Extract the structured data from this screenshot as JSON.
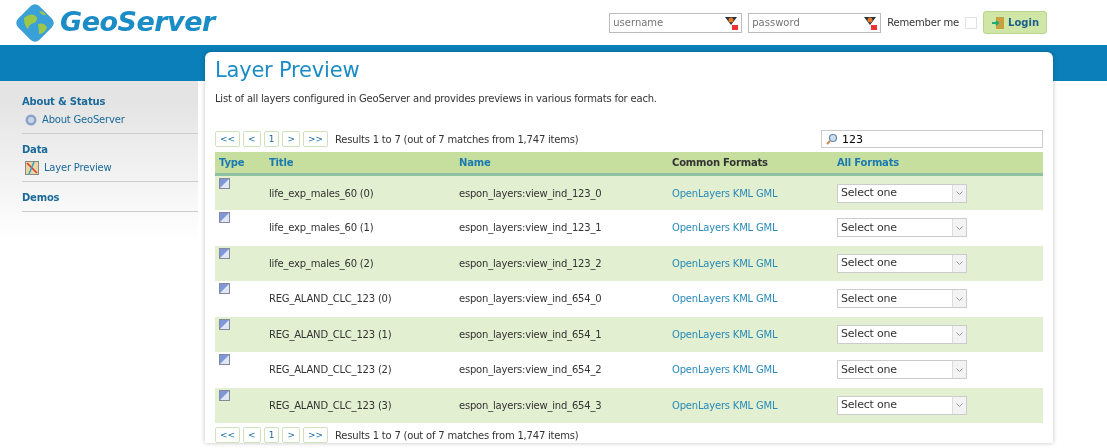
{
  "logo": {
    "text": "GeoServer"
  },
  "login": {
    "username_placeholder": "username",
    "password_placeholder": "password",
    "remember_label": "Remember me",
    "remember_checked": false,
    "button": "Login"
  },
  "sidebar": {
    "sections": [
      {
        "title": "About & Status",
        "items": [
          {
            "label": "About GeoServer"
          }
        ]
      },
      {
        "title": "Data",
        "items": [
          {
            "label": "Layer Preview"
          }
        ]
      },
      {
        "title": "Demos"
      }
    ]
  },
  "page": {
    "title": "Layer Preview",
    "description": "List of all layers configured in GeoServer and provides previews in various formats for each."
  },
  "pager_top": {
    "buttons": [
      "<<",
      "<",
      "1",
      ">",
      ">>"
    ],
    "summary": "Results 1 to 7 (out of 7 matches from 1,747 items)"
  },
  "search": {
    "value": "123"
  },
  "table": {
    "columns": [
      "Type",
      "Title",
      "Name",
      "Common Formats",
      "All Formats"
    ],
    "rows": [
      {
        "title": "life_exp_males_60 (0)",
        "name": "espon_layers:view_ind_123_0",
        "formats": [
          "OpenLayers",
          "KML",
          "GML"
        ],
        "select": "Select one"
      },
      {
        "title": "life_exp_males_60 (1)",
        "name": "espon_layers:view_ind_123_1",
        "formats": [
          "OpenLayers",
          "KML",
          "GML"
        ],
        "select": "Select one"
      },
      {
        "title": "life_exp_males_60 (2)",
        "name": "espon_layers:view_ind_123_2",
        "formats": [
          "OpenLayers",
          "KML",
          "GML"
        ],
        "select": "Select one"
      },
      {
        "title": "REG_ALAND_CLC_123 (0)",
        "name": "espon_layers:view_ind_654_0",
        "formats": [
          "OpenLayers",
          "KML",
          "GML"
        ],
        "select": "Select one"
      },
      {
        "title": "REG_ALAND_CLC_123 (1)",
        "name": "espon_layers:view_ind_654_1",
        "formats": [
          "OpenLayers",
          "KML",
          "GML"
        ],
        "select": "Select one"
      },
      {
        "title": "REG_ALAND_CLC_123 (2)",
        "name": "espon_layers:view_ind_654_2",
        "formats": [
          "OpenLayers",
          "KML",
          "GML"
        ],
        "select": "Select one"
      },
      {
        "title": "REG_ALAND_CLC_123 (3)",
        "name": "espon_layers:view_ind_654_3",
        "formats": [
          "OpenLayers",
          "KML",
          "GML"
        ],
        "select": "Select one"
      }
    ]
  },
  "pager_bottom": {
    "buttons": [
      "<<",
      "<",
      "1",
      ">",
      ">>"
    ],
    "summary": "Results 1 to 7 (out of 7 matches from 1,747 items)"
  }
}
